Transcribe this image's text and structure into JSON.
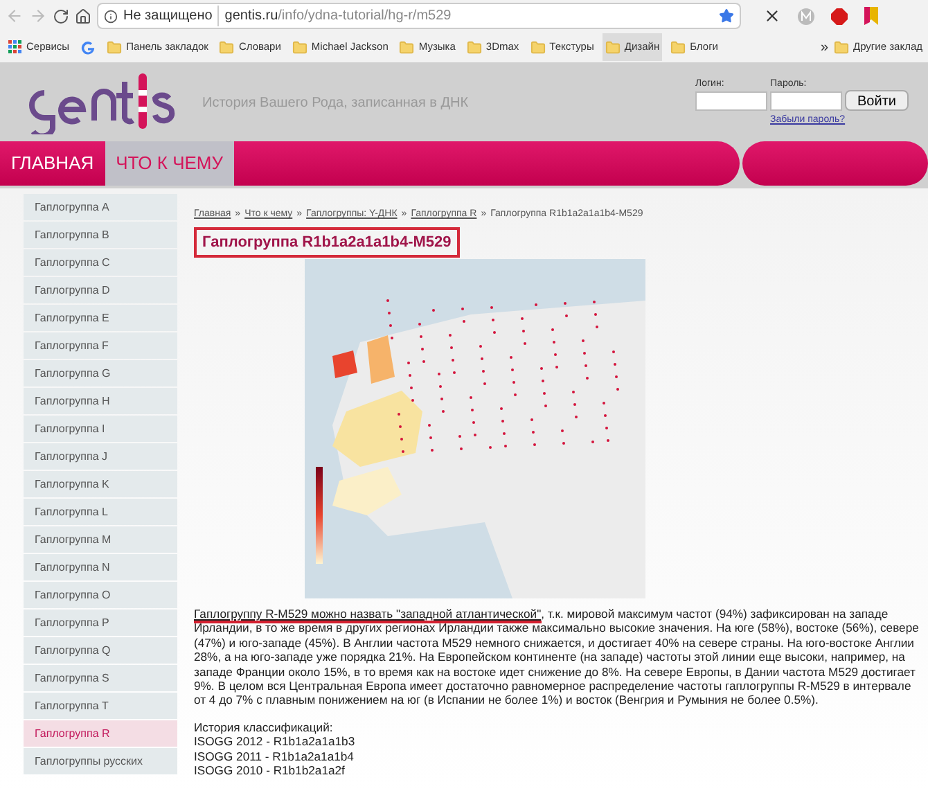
{
  "browser": {
    "security": "Не защищено",
    "url_host": "gentis.ru",
    "url_path": "/info/ydna-tutorial/hg-r/m529",
    "bookmarks": [
      {
        "kind": "apps",
        "label": "Сервисы"
      },
      {
        "kind": "google"
      },
      {
        "kind": "folder",
        "label": "Панель закладок"
      },
      {
        "kind": "folder",
        "label": "Словари"
      },
      {
        "kind": "folder",
        "label": "Michael Jackson"
      },
      {
        "kind": "folder",
        "label": "Музыка"
      },
      {
        "kind": "folder",
        "label": "3Dmax"
      },
      {
        "kind": "folder",
        "label": "Текстуры"
      },
      {
        "kind": "folder",
        "label": "Дизайн",
        "selected": true
      },
      {
        "kind": "folder",
        "label": "Блоги"
      }
    ],
    "overflow": "»",
    "other_bookmarks": "Другие заклад"
  },
  "header": {
    "tagline": "История Вашего Рода, записанная в ДНК",
    "login_label": "Логин:",
    "password_label": "Пароль:",
    "login_button": "Войти",
    "forgot_link": "Забыли пароль?"
  },
  "nav": [
    {
      "label": "ГЛАВНАЯ",
      "selected": false
    },
    {
      "label": "ЧТО К ЧЕМУ",
      "selected": true
    }
  ],
  "sidebar": [
    {
      "label": "Гаплогруппа A",
      "selected": false
    },
    {
      "label": "Гаплогруппа B",
      "selected": false
    },
    {
      "label": "Гаплогруппа C",
      "selected": false
    },
    {
      "label": "Гаплогруппа D",
      "selected": false
    },
    {
      "label": "Гаплогруппа E",
      "selected": false
    },
    {
      "label": "Гаплогруппа F",
      "selected": false
    },
    {
      "label": "Гаплогруппа G",
      "selected": false
    },
    {
      "label": "Гаплогруппа H",
      "selected": false
    },
    {
      "label": "Гаплогруппа I",
      "selected": false
    },
    {
      "label": "Гаплогруппа J",
      "selected": false
    },
    {
      "label": "Гаплогруппа K",
      "selected": false
    },
    {
      "label": "Гаплогруппа L",
      "selected": false
    },
    {
      "label": "Гаплогруппа M",
      "selected": false
    },
    {
      "label": "Гаплогруппа N",
      "selected": false
    },
    {
      "label": "Гаплогруппа O",
      "selected": false
    },
    {
      "label": "Гаплогруппа P",
      "selected": false
    },
    {
      "label": "Гаплогруппа Q",
      "selected": false
    },
    {
      "label": "Гаплогруппа S",
      "selected": false
    },
    {
      "label": "Гаплогруппа T",
      "selected": false
    },
    {
      "label": "Гаплогруппа R",
      "selected": true
    },
    {
      "label": "Гаплогруппы русских",
      "selected": false
    }
  ],
  "breadcrumb": {
    "links": [
      "Главная",
      "Что к чему",
      "Гаплогруппы: Y-ДНК",
      "Гаплогруппа R"
    ],
    "separator": "»",
    "current": "Гаплогруппа R1b1a2a1a1b4-M529"
  },
  "title": "Гаплогруппа R1b1a2a1a1b4-M529",
  "paragraph": {
    "link": "Гаплогруппу R-M529 можно назвать \"западной атлантической\"",
    "text": ", т.к. мировой максимум частот (94%) зафиксирован на западе Ирландии, в то же время в других регионах Ирландии также максимально высокие значения. На юге (58%), востоке (56%), севере (47%) и юго-западе (45%). В Англии частота M529 немного снижается, и достигает 40% на севере страны. На юго-востоке Англии 28%, а на юго-западе уже порядка 21%. На Европейском континенте (на западе) частоты этой линии еще высоки, например, на западе Франции около 15%, в то время как на востоке идет снижение до 8%. На севере Европы, в Дании частота M529 достигает 9%. В целом вся Центральная Европа имеет достаточно равномерное распределение частоты гаплогруппы R-M529 в интервале от 4 до 7% с плавным понижением на юг (в Испании не более 1%) и восток (Венгрия и Румыния не более 0.5%)."
  },
  "history": {
    "heading": "История классификаций:",
    "items": [
      "ISOGG 2012 - R1b1a2a1a1b3",
      "ISOGG 2011 - R1b1a2a1a1b4",
      "ISOGG 2010 - R1b1b2a1a2f"
    ]
  }
}
